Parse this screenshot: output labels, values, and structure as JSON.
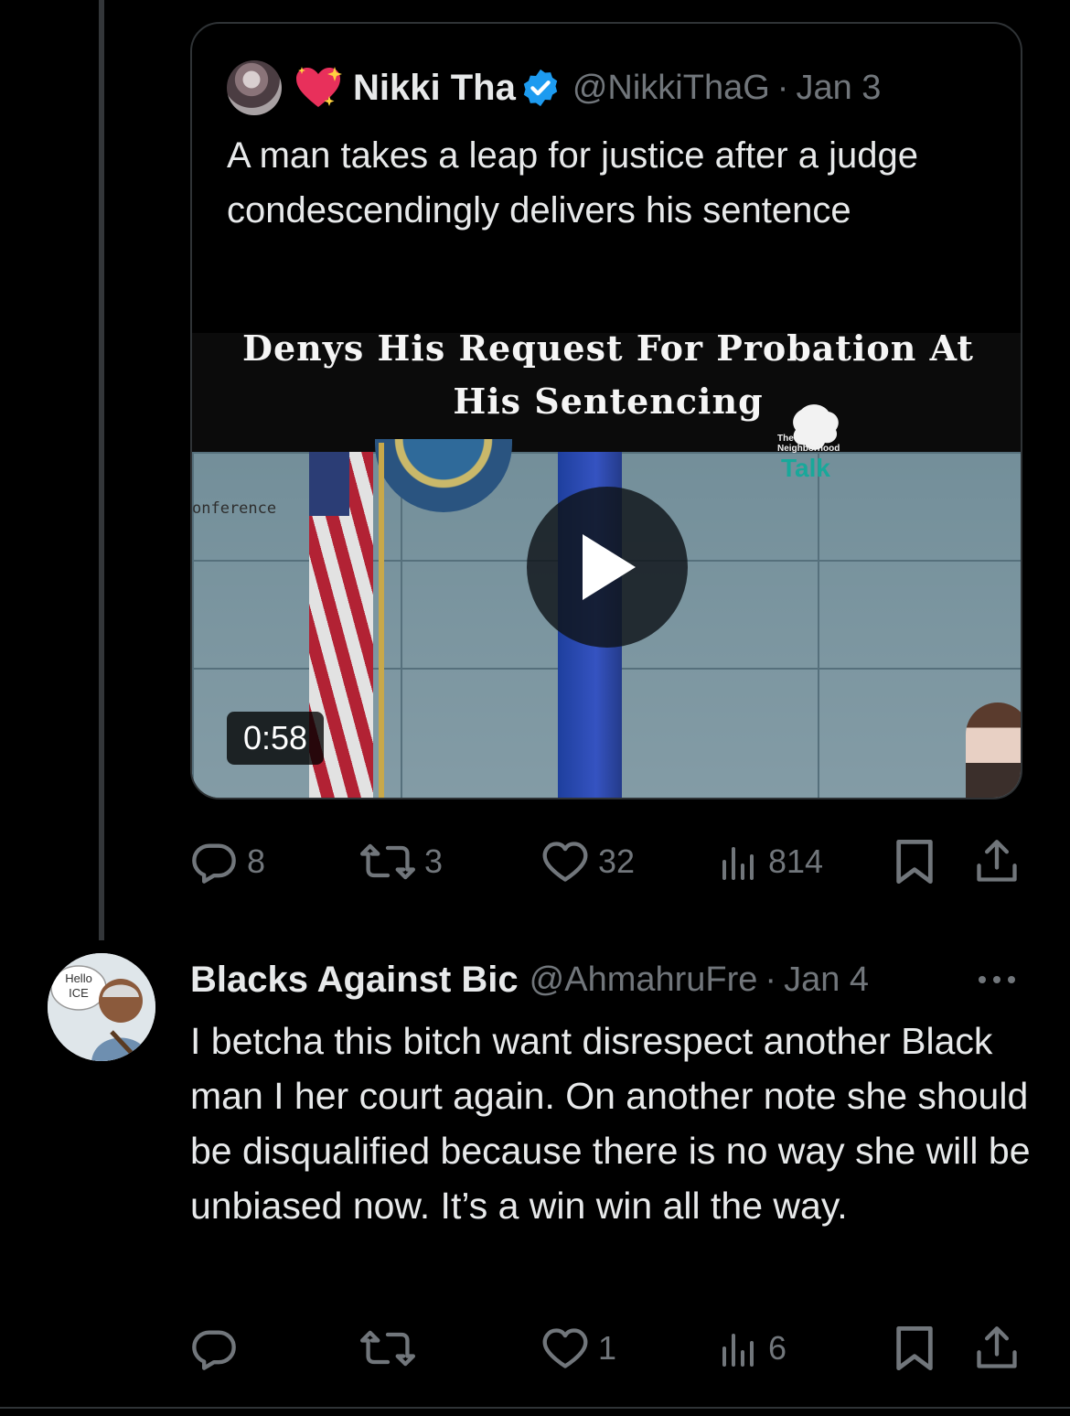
{
  "quoted_tweet": {
    "author_name": "Nikki Tha",
    "author_handle": "@NikkiThaG",
    "separator": "·",
    "date": "Jan 3",
    "text": "A man takes a leap for justice after a judge condescendingly delivers his sentence",
    "video": {
      "caption_line1": "Denys His Request For Probation At",
      "caption_line2": "His Sentencing",
      "watermark_top": "The",
      "watermark_mid": "Neighborhood",
      "watermark_brand": "Talk",
      "background_text": "onference",
      "duration": "0:58"
    }
  },
  "main_tweet_actions": {
    "replies": "8",
    "reposts": "3",
    "likes": "32",
    "views": "814"
  },
  "reply_tweet": {
    "author_name": "Blacks Against Bic",
    "author_handle": "@AhmahruFre",
    "separator": "·",
    "date": "Jan 4",
    "avatar_sign": "Hello ICE",
    "text": "I betcha this bitch want disrespect another Black man I her court again. On another note she should be disqualified because there is no way she will be unbiased now. It’s a win win all the way.",
    "actions": {
      "replies": "",
      "reposts": "",
      "likes": "1",
      "views": "6"
    }
  },
  "colors": {
    "background": "#000000",
    "text_primary": "#e7e9ea",
    "text_secondary": "#71767b",
    "verified": "#1d9bf0",
    "border": "#2f3336"
  }
}
